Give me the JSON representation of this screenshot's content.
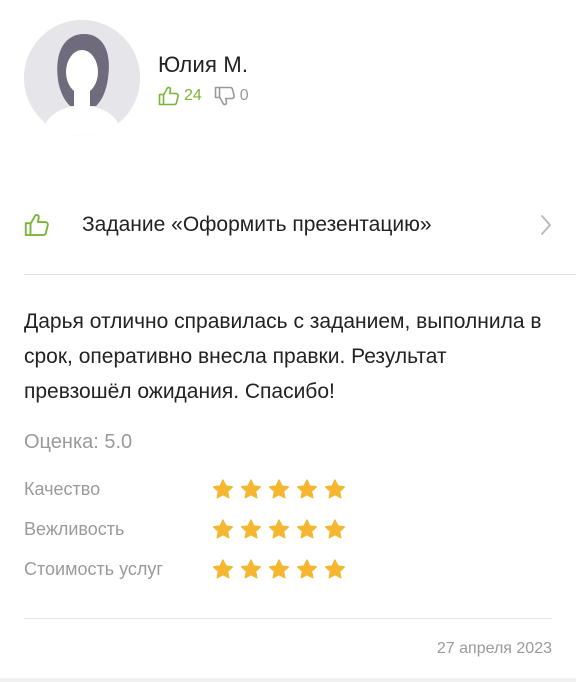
{
  "user": {
    "name": "Юлия М.",
    "likes": "24",
    "dislikes": "0"
  },
  "task": {
    "label": "Задание «Оформить презентацию»"
  },
  "review": {
    "text": "Дарья отлично справилась с заданием, выполнила в срок, оперативно внесла правки. Результат превзошёл ожидания. Спасибо!",
    "score_label": "Оценка: 5.0",
    "ratings": [
      {
        "label": "Качество",
        "stars": 5
      },
      {
        "label": "Вежливость",
        "stars": 5
      },
      {
        "label": "Стоимость услуг",
        "stars": 5
      }
    ],
    "date": "27 апреля 2023"
  },
  "icons": {
    "like": "thumbs-up-icon",
    "dislike": "thumbs-down-icon",
    "chevron": "chevron-right-icon",
    "star": "star-icon"
  },
  "colors": {
    "accent_green": "#7ab43a",
    "star": "#f5b730",
    "muted_text": "#9a9a9a"
  }
}
